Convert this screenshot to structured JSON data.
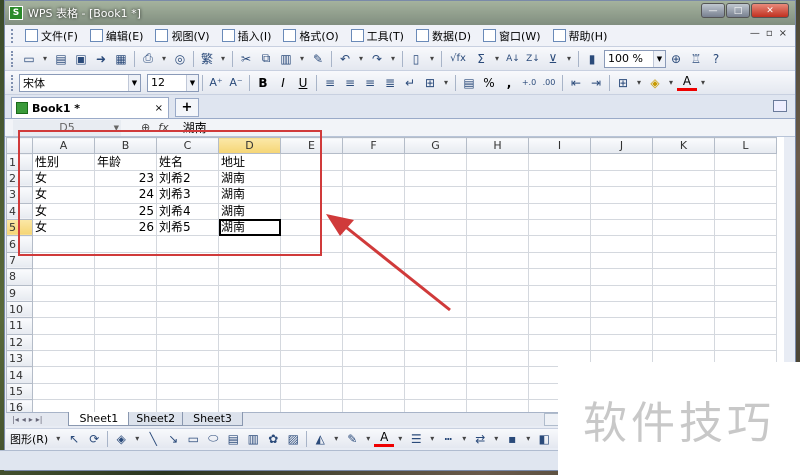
{
  "window": {
    "title": "WPS 表格 - [Book1 *]",
    "app_icon": "S",
    "buttons": [
      "—",
      "□",
      "✕"
    ]
  },
  "menu": {
    "items": [
      "文件(F)",
      "编辑(E)",
      "视图(V)",
      "插入(I)",
      "格式(O)",
      "工具(T)",
      "数据(D)",
      "窗口(W)",
      "帮助(H)"
    ],
    "right_controls": [
      "—",
      "▫",
      "×"
    ]
  },
  "toolbar": {
    "zoom": "100 %",
    "sum_icon": "Σ",
    "az_icon": "A↓",
    "fx_icon": "√fx"
  },
  "format": {
    "font_name": "宋体",
    "font_size": "12",
    "bold": "B",
    "italic": "I",
    "underline": "U",
    "percent": "%",
    "comma": ",",
    "inc_font": "A⁺",
    "dec_font": "A⁻",
    "font_color": "A"
  },
  "doctab": {
    "name": "Book1 *",
    "close": "×",
    "new_tab": "+"
  },
  "formula_bar": {
    "cell_ref": "D5",
    "fx_label": "fx",
    "content": "湖南"
  },
  "grid": {
    "columns": [
      "A",
      "B",
      "C",
      "D",
      "E",
      "F",
      "G",
      "H",
      "I",
      "J",
      "K",
      "L"
    ],
    "rows": [
      [
        "性别",
        "年龄",
        "姓名",
        "地址"
      ],
      [
        "女",
        "23",
        "刘希2",
        "湖南"
      ],
      [
        "女",
        "24",
        "刘希3",
        "湖南"
      ],
      [
        "女",
        "25",
        "刘希4",
        "湖南"
      ],
      [
        "女",
        "26",
        "刘希5",
        "湖南"
      ]
    ],
    "row_numbers": [
      "1",
      "2",
      "3",
      "4",
      "5",
      "6",
      "7",
      "8",
      "9",
      "10",
      "11",
      "12",
      "13",
      "14",
      "15",
      "16"
    ],
    "selected_column": "D",
    "selected_row": "5"
  },
  "sheets": [
    "Sheet1",
    "Sheet2",
    "Sheet3"
  ],
  "drawbar": {
    "shapes_label": "图形(R)"
  },
  "watermark": "软件技巧",
  "colors": {
    "annotation": "#d03a3a",
    "header_selected": "#f5d575"
  }
}
